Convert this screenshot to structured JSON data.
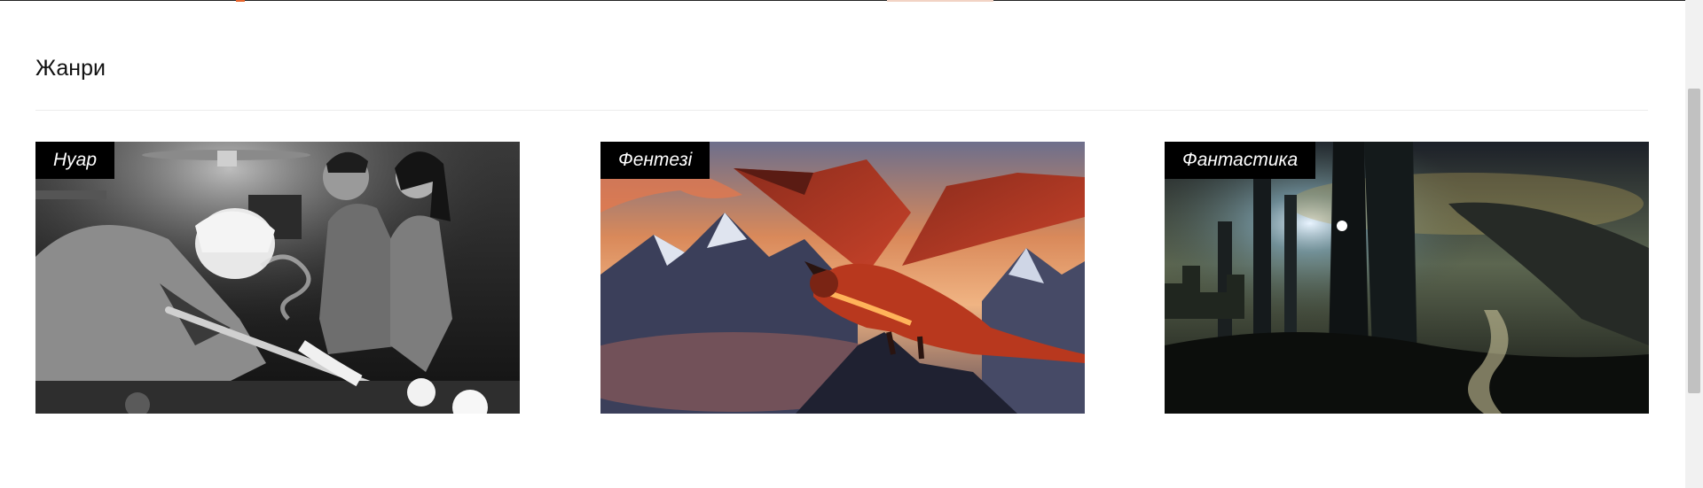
{
  "section": {
    "title": "Жанри"
  },
  "genres": [
    {
      "label": "Нуар",
      "image_alt": "noir-billiards-illustration"
    },
    {
      "label": "Фентезі",
      "image_alt": "dragon-over-mountains-illustration"
    },
    {
      "label": "Фантастика",
      "image_alt": "sci-fi-ruined-city-illustration"
    }
  ],
  "colors": {
    "accent": "#e8642c",
    "tag_bg": "#000000",
    "tag_text": "#ffffff"
  }
}
